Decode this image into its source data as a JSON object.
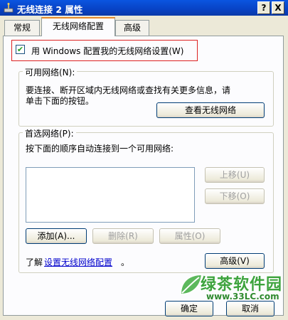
{
  "window": {
    "title": "无线连接 2 属性",
    "help_label": "?",
    "close_label": "X"
  },
  "tabs": [
    {
      "label": "常规"
    },
    {
      "label": "无线网络配置",
      "selected": true
    },
    {
      "label": "高级"
    }
  ],
  "checkbox": {
    "label": "用 Windows 配置我的无线网络设置(W)",
    "checked": true,
    "check_glyph": "✔"
  },
  "available_networks": {
    "label": "可用网络(N):",
    "desc_line1": "要连接、断开区域内无线网络或查找有关更多信息，请",
    "desc_line2": "单击下面的按钮。",
    "view_button": "查看无线网络"
  },
  "preferred_networks": {
    "label": "首选网络(P):",
    "desc": "按下面的顺序自动连接到一个可用网络:",
    "move_up": "上移(U)",
    "move_down": "下移(O)",
    "add": "添加(A)...",
    "delete": "删除(R)",
    "properties": "属性(O)"
  },
  "learn_more": {
    "prefix": "了解",
    "link": "设置无线网络配置",
    "suffix": "。"
  },
  "advanced_button": "高级(V)",
  "footer": {
    "ok": "确定",
    "cancel": "取消"
  },
  "watermark": {
    "text": "绿茶软件园",
    "url": "www.33LC.com"
  },
  "colors": {
    "titlebar": "#0842c4",
    "highlight_border": "#dd2222",
    "link": "#0000cc",
    "watermark_green": "#3da33d"
  }
}
